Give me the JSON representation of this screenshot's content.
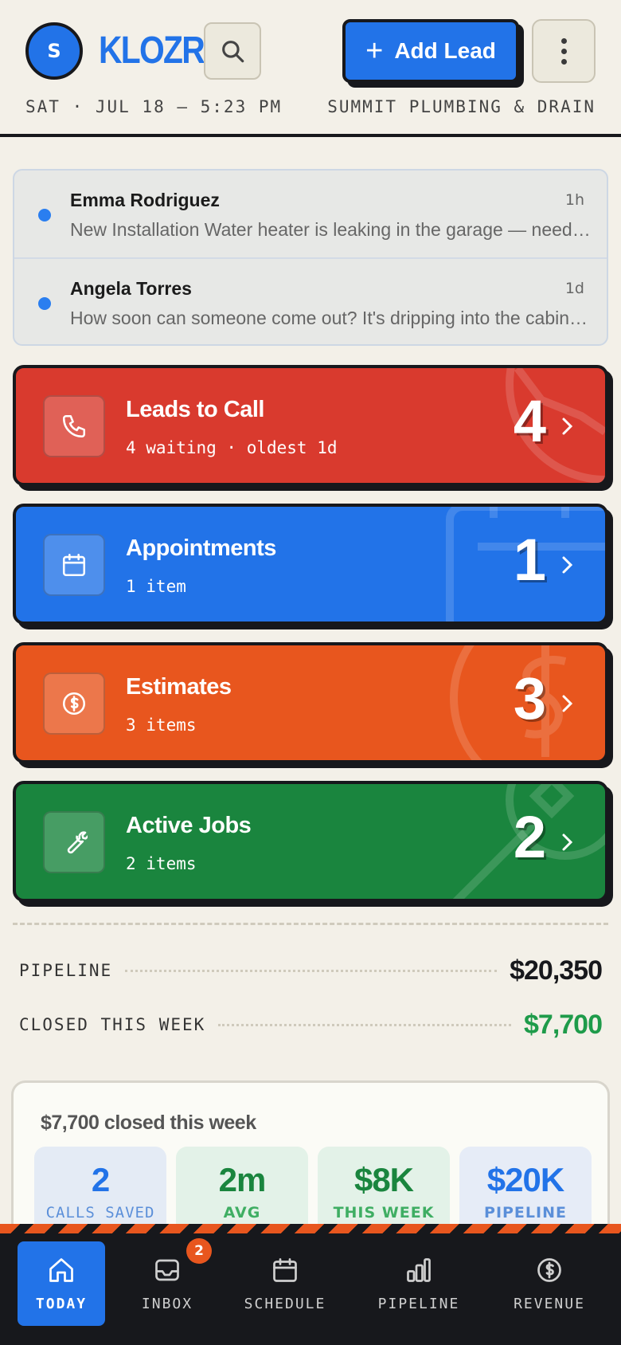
{
  "header": {
    "avatar_initial": "S",
    "logo": "KLOZR",
    "add_lead_label": "Add Lead",
    "date_line": "SAT · JUL 18 — 5:23 PM",
    "company": "SUMMIT PLUMBING & DRAIN"
  },
  "messages": [
    {
      "name": "Emma Rodriguez",
      "time": "1h",
      "preview": "New Installation Water heater is leaking in the garage — need someone today"
    },
    {
      "name": "Angela Torres",
      "time": "1d",
      "preview": "How soon can someone come out? It's dripping into the cabinet under the sink"
    }
  ],
  "cards": [
    {
      "title": "Leads to Call",
      "sub": "4 waiting · oldest 1d",
      "count": "4",
      "color": "#d93a2e",
      "icon": "phone-icon"
    },
    {
      "title": "Appointments",
      "sub": "1 item",
      "count": "1",
      "color": "#2273e8",
      "icon": "calendar-icon"
    },
    {
      "title": "Estimates",
      "sub": "3 items",
      "count": "3",
      "color": "#e8561e",
      "icon": "dollar-icon"
    },
    {
      "title": "Active Jobs",
      "sub": "2 items",
      "count": "2",
      "color": "#1a853e",
      "icon": "wrench-icon"
    }
  ],
  "stats": {
    "pipeline_label": "PIPELINE",
    "pipeline_value": "$20,350",
    "closed_label": "CLOSED THIS WEEK",
    "closed_value": "$7,700"
  },
  "summary": {
    "heading": "$7,700 closed this week",
    "tiles": [
      {
        "value": "2",
        "label": "CALLS SAVED"
      },
      {
        "value": "2m",
        "label": "AVG RESPONSE"
      },
      {
        "value": "$8K",
        "label": "THIS WEEK"
      },
      {
        "value": "$20K",
        "label": "PIPELINE"
      }
    ]
  },
  "nav": {
    "items": [
      {
        "label": "TODAY",
        "icon": "home-icon",
        "active": true
      },
      {
        "label": "INBOX",
        "icon": "inbox-icon",
        "badge": "2"
      },
      {
        "label": "SCHEDULE",
        "icon": "calendar-icon"
      },
      {
        "label": "PIPELINE",
        "icon": "bar-chart-icon"
      },
      {
        "label": "REVENUE",
        "icon": "dollar-icon"
      }
    ]
  },
  "colors": {
    "accent_blue": "#2273e8",
    "red": "#d93a2e",
    "orange": "#e8561e",
    "green": "#1a853e",
    "dark": "#17181c",
    "background": "#f3f0e8"
  }
}
